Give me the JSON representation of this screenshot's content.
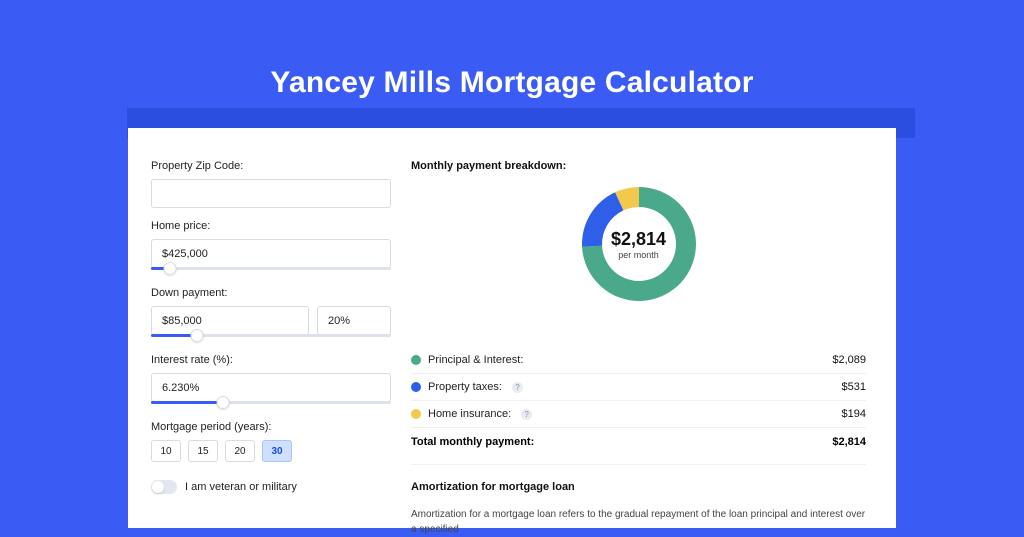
{
  "page_title": "Yancey Mills Mortgage Calculator",
  "form": {
    "zip_label": "Property Zip Code:",
    "zip_value": "",
    "home_price_label": "Home price:",
    "home_price_value": "$425,000",
    "home_price_slider_pct": 8,
    "down_payment_label": "Down payment:",
    "down_payment_value": "$85,000",
    "down_payment_pct_value": "20%",
    "down_payment_slider_pct": 19,
    "interest_label": "Interest rate (%):",
    "interest_value": "6.230%",
    "interest_slider_pct": 30,
    "period_label": "Mortgage period (years):",
    "periods": [
      "10",
      "15",
      "20",
      "30"
    ],
    "period_selected": "30",
    "vet_label": "I am veteran or military",
    "vet_on": false
  },
  "breakdown": {
    "title": "Monthly payment breakdown:",
    "center_amount": "$2,814",
    "center_sub": "per month",
    "items": [
      {
        "name": "Principal & Interest:",
        "value": "$2,089",
        "color": "#4aa98b",
        "has_info": false
      },
      {
        "name": "Property taxes:",
        "value": "$531",
        "color": "#2f5fe8",
        "has_info": true
      },
      {
        "name": "Home insurance:",
        "value": "$194",
        "color": "#f2c94c",
        "has_info": true
      }
    ],
    "total_label": "Total monthly payment:",
    "total_value": "$2,814"
  },
  "amortization": {
    "title": "Amortization for mortgage loan",
    "body": "Amortization for a mortgage loan refers to the gradual repayment of the loan principal and interest over a specified"
  },
  "chart_data": {
    "type": "pie",
    "title": "Monthly payment breakdown",
    "series": [
      {
        "name": "Principal & Interest",
        "value": 2089,
        "color": "#4aa98b"
      },
      {
        "name": "Property taxes",
        "value": 531,
        "color": "#2f5fe8"
      },
      {
        "name": "Home insurance",
        "value": 194,
        "color": "#f2c94c"
      }
    ],
    "total": 2814,
    "inner_radius_ratio": 0.64
  }
}
